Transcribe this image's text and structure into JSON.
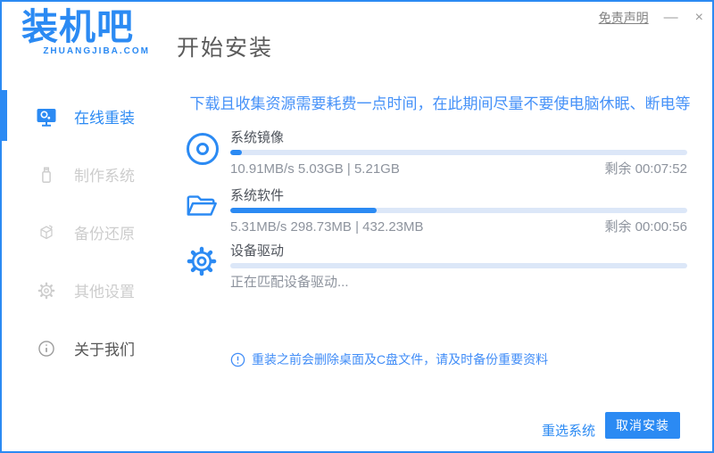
{
  "colors": {
    "accent": "#2b8af3",
    "warning_text": "#4591f8",
    "track": "#dce7f8"
  },
  "header": {
    "logo_text": "装机吧",
    "logo_subtext": "ZHUANGJIBA.COM",
    "page_title": "开始安装",
    "disclaimer": "免责声明",
    "minimize": "—",
    "close": "×"
  },
  "sidebar": {
    "items": [
      {
        "label": "在线重装",
        "icon": "monitor-icon",
        "active": true
      },
      {
        "label": "制作系统",
        "icon": "usb-drive-icon",
        "active": false
      },
      {
        "label": "备份还原",
        "icon": "backup-cube-icon",
        "active": false
      },
      {
        "label": "其他设置",
        "icon": "gear-icon",
        "active": false
      },
      {
        "label": "关于我们",
        "icon": "info-circle-icon",
        "active": false
      }
    ]
  },
  "main": {
    "warning": "下载且收集资源需要耗费一点时间，在此期间尽量不要使电脑休眠、断电等",
    "tasks": [
      {
        "name": "系统镜像",
        "icon": "disc-icon",
        "stats": "10.91MB/s 5.03GB | 5.21GB",
        "remaining": "剩余 00:07:52",
        "progress_pct": 2.5
      },
      {
        "name": "系统软件",
        "icon": "open-folder-icon",
        "stats": "5.31MB/s 298.73MB | 432.23MB",
        "remaining": "剩余 00:00:56",
        "progress_pct": 32
      },
      {
        "name": "设备驱动",
        "icon": "gear-icon",
        "stats": "正在匹配设备驱动...",
        "remaining": "",
        "progress_pct": 0
      }
    ],
    "note": "重装之前会删除桌面及C盘文件，请及时备份重要资料"
  },
  "footer": {
    "reselect_label": "重选系统",
    "cancel_label": "取消安装"
  }
}
